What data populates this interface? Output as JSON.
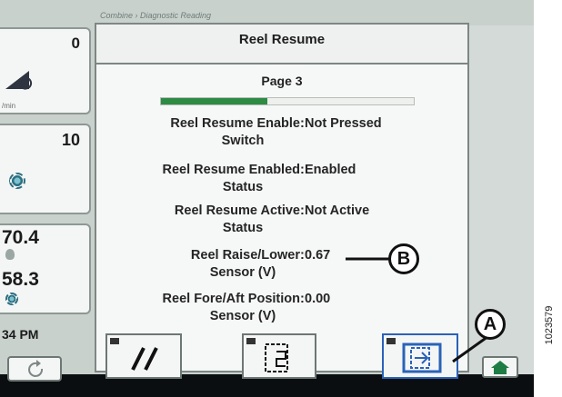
{
  "breadcrumb": "Combine › Diagnostic Reading",
  "title": "Reel Resume",
  "page_label": "Page 3",
  "progress_fraction": 0.42,
  "rows": [
    {
      "label_line1": "Reel Resume Enable",
      "label_line2": "Switch",
      "value": "Not Pressed"
    },
    {
      "label_line1": "Reel Resume Enabled",
      "label_line2": "Status",
      "value": "Enabled"
    },
    {
      "label_line1": "Reel Resume Active",
      "label_line2": "Status",
      "value": "Not Active"
    },
    {
      "label_line1": "Reel Raise/Lower",
      "label_line2": "Sensor (V)",
      "value": "0.67"
    },
    {
      "label_line1": "Reel Fore/Aft Position",
      "label_line2": "Sensor (V)",
      "value": "0.00"
    }
  ],
  "left_widgets": {
    "w1_value": "0",
    "w1_unit": "/min",
    "w2_value": "10",
    "w3_value_a": "70.4",
    "w3_value_b": "58.3",
    "time": "34 PM"
  },
  "callouts": {
    "a": "A",
    "b": "B"
  },
  "figure_id": "1023579",
  "icons": [
    "reel-height-icon",
    "gear-icon",
    "shift-icon",
    "menu-icon",
    "exit-icon",
    "home-icon",
    "refresh-icon"
  ]
}
